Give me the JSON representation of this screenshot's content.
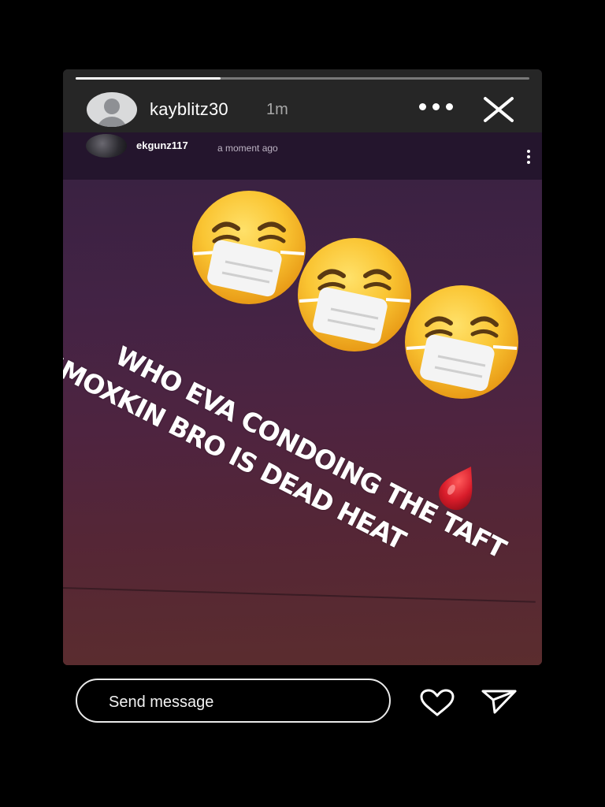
{
  "story": {
    "progress": 0.32,
    "user": {
      "username": "kayblitz30",
      "time_ago": "1m",
      "avatar_icon": "default-avatar-icon"
    },
    "more_icon": "more-horizontal-icon",
    "close_icon": "close-icon"
  },
  "repost": {
    "username": "ekgunz117",
    "time_ago": "a moment ago",
    "menu_icon": "more-vertical-icon"
  },
  "content": {
    "caption_line1": "WHO EVA CONDOING THE TAFT",
    "caption_line2": "SMOXKIN BRO IS DEAD HEAT",
    "stickers": [
      "face-with-medical-mask-icon",
      "face-with-medical-mask-icon",
      "face-with-medical-mask-icon",
      "drop-of-blood-icon"
    ]
  },
  "footer": {
    "message_placeholder": "Send message",
    "like_icon": "heart-icon",
    "share_icon": "paper-plane-icon"
  },
  "colors": {
    "background": "#000000",
    "header": "#262626",
    "emoji_yellow": "#f8c12e",
    "blood_red": "#d81c2a"
  }
}
